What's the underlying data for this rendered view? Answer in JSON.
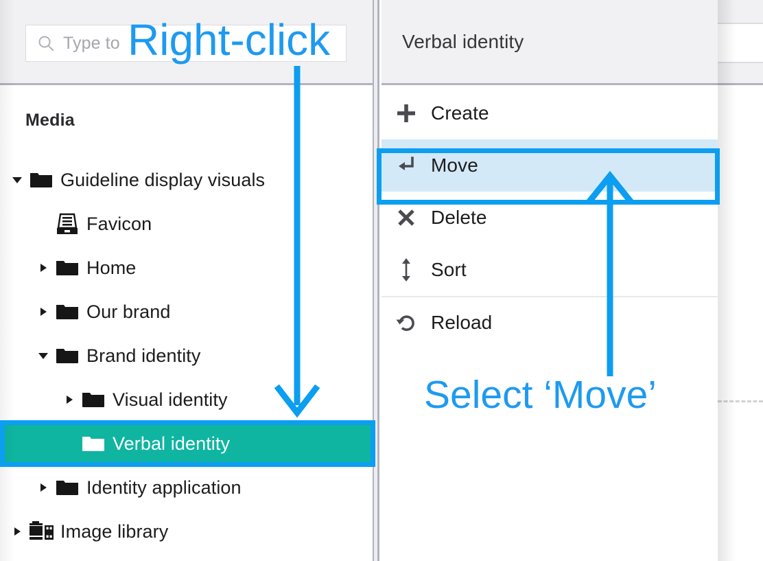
{
  "left_panel": {
    "search": {
      "placeholder": "Type to",
      "icon": "search-icon"
    },
    "section_label": "Media",
    "tree": [
      {
        "label": "Guideline display visuals",
        "icon": "folder-icon",
        "caret": "down",
        "depth": 0,
        "selected": false
      },
      {
        "label": "Favicon",
        "icon": "archive-icon",
        "caret": "none",
        "depth": 1,
        "selected": false
      },
      {
        "label": "Home",
        "icon": "folder-icon",
        "caret": "right",
        "depth": 1,
        "selected": false
      },
      {
        "label": "Our brand",
        "icon": "folder-icon",
        "caret": "right",
        "depth": 1,
        "selected": false
      },
      {
        "label": "Brand identity",
        "icon": "folder-icon",
        "caret": "down",
        "depth": 1,
        "selected": false
      },
      {
        "label": "Visual identity",
        "icon": "folder-icon",
        "caret": "right",
        "depth": 2,
        "selected": false
      },
      {
        "label": "Verbal identity",
        "icon": "folder-open-icon",
        "caret": "none",
        "depth": 2,
        "selected": true
      },
      {
        "label": "Identity application",
        "icon": "folder-icon",
        "caret": "right",
        "depth": 1,
        "selected": false
      },
      {
        "label": "Image library",
        "icon": "film-icon",
        "caret": "right",
        "depth": 0,
        "selected": false
      }
    ]
  },
  "context_menu": {
    "title": "Verbal identity",
    "items": [
      {
        "label": "Create",
        "icon": "plus-icon",
        "active": false,
        "separator_above": false
      },
      {
        "label": "Move",
        "icon": "enter-arrow-icon",
        "active": true,
        "separator_above": false
      },
      {
        "label": "Delete",
        "icon": "cross-icon",
        "active": false,
        "separator_above": false
      },
      {
        "label": "Sort",
        "icon": "up-down-arrow-icon",
        "active": false,
        "separator_above": false
      },
      {
        "label": "Reload",
        "icon": "reload-icon",
        "active": false,
        "separator_above": true
      }
    ]
  },
  "annotations": {
    "right_click": "Right-click",
    "select_move": "Select ‘Move’"
  },
  "colors": {
    "annotation_blue": "#0c9ef0",
    "selection_teal": "#0fb5a0",
    "menu_active_blue": "#d4e9f7",
    "header_grey": "#f1f1f4",
    "divider_grey": "#b2b2bf"
  }
}
